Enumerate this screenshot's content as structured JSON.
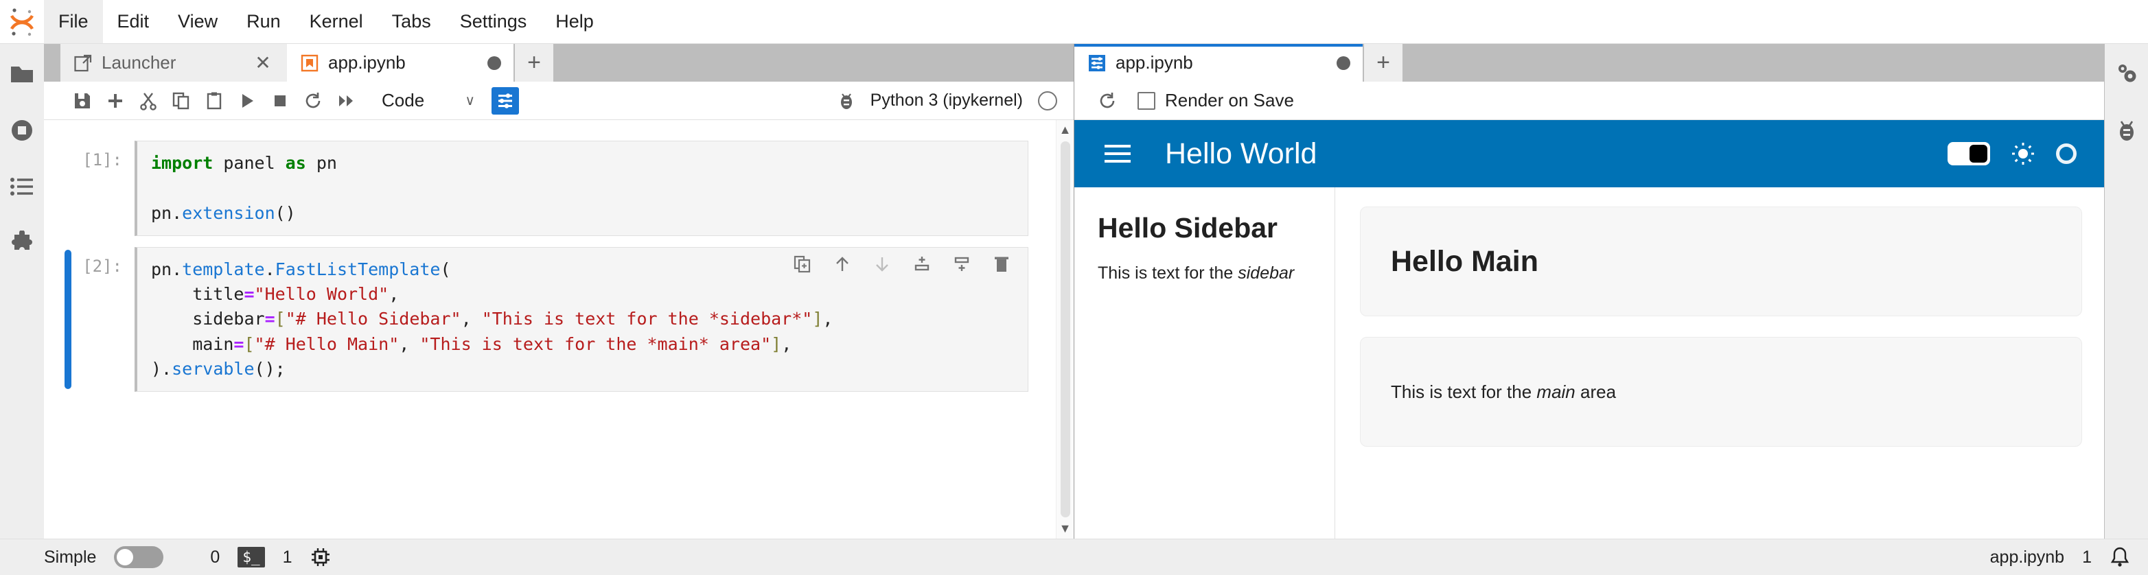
{
  "app": {
    "logo_name": "jupyter-logo"
  },
  "menubar": {
    "items": [
      {
        "label": "File",
        "active": true
      },
      {
        "label": "Edit",
        "active": false
      },
      {
        "label": "View",
        "active": false
      },
      {
        "label": "Run",
        "active": false
      },
      {
        "label": "Kernel",
        "active": false
      },
      {
        "label": "Tabs",
        "active": false
      },
      {
        "label": "Settings",
        "active": false
      },
      {
        "label": "Help",
        "active": false
      }
    ]
  },
  "left_rail": {
    "icons": [
      "folder-icon",
      "running-sessions-icon",
      "commands-icon",
      "extensions-icon"
    ]
  },
  "right_rail": {
    "icons": [
      "property-inspector-icon",
      "debugger-icon"
    ]
  },
  "notebook_dock": {
    "tabs": [
      {
        "label": "Launcher",
        "icon": "launcher-icon",
        "close_label": "✕",
        "current": false
      },
      {
        "label": "app.ipynb",
        "icon": "notebook-icon",
        "current": true,
        "dirty": true
      }
    ],
    "add_tab_label": "+",
    "toolbar": {
      "buttons": [
        "save-icon",
        "insert-cell-icon",
        "cut-icon",
        "copy-icon",
        "paste-icon",
        "run-icon",
        "stop-icon",
        "restart-icon",
        "restart-run-all-icon"
      ],
      "cell_type": "Code",
      "cell_type_caret": "∨",
      "settings_icon": "sliders-icon",
      "debug_icon": "bug-icon",
      "kernel_name": "Python 3 (ipykernel)",
      "kernel_status": "idle"
    },
    "cells": [
      {
        "prompt": "[1]:",
        "selected": false,
        "lines": [
          [
            {
              "t": "import",
              "c": "kw"
            },
            {
              "t": " panel ",
              "c": ""
            },
            {
              "t": "as",
              "c": "kw"
            },
            {
              "t": " pn",
              "c": ""
            }
          ],
          [],
          [
            {
              "t": "pn.",
              "c": ""
            },
            {
              "t": "extension",
              "c": "fn"
            },
            {
              "t": "()",
              "c": ""
            }
          ]
        ]
      },
      {
        "prompt": "[2]:",
        "selected": true,
        "lines": [
          [
            {
              "t": "pn.",
              "c": ""
            },
            {
              "t": "template",
              "c": "fn"
            },
            {
              "t": ".",
              "c": ""
            },
            {
              "t": "FastListTemplate",
              "c": "fn"
            },
            {
              "t": "(",
              "c": ""
            }
          ],
          [
            {
              "t": "    title",
              "c": ""
            },
            {
              "t": "=",
              "c": "op"
            },
            {
              "t": "\"Hello World\"",
              "c": "str"
            },
            {
              "t": ",",
              "c": ""
            }
          ],
          [
            {
              "t": "    sidebar",
              "c": ""
            },
            {
              "t": "=",
              "c": "op"
            },
            {
              "t": "[",
              "c": "brk"
            },
            {
              "t": "\"# Hello Sidebar\"",
              "c": "str"
            },
            {
              "t": ", ",
              "c": ""
            },
            {
              "t": "\"This is text for the *sidebar*\"",
              "c": "str"
            },
            {
              "t": "]",
              "c": "brk"
            },
            {
              "t": ",",
              "c": ""
            }
          ],
          [
            {
              "t": "    main",
              "c": ""
            },
            {
              "t": "=",
              "c": "op"
            },
            {
              "t": "[",
              "c": "brk"
            },
            {
              "t": "\"# Hello Main\"",
              "c": "str"
            },
            {
              "t": ", ",
              "c": ""
            },
            {
              "t": "\"This is text for the *main* area\"",
              "c": "str"
            },
            {
              "t": "]",
              "c": "brk"
            },
            {
              "t": ",",
              "c": ""
            }
          ],
          [
            {
              "t": ")",
              "c": ""
            },
            {
              "t": ".",
              "c": ""
            },
            {
              "t": "servable",
              "c": "fn"
            },
            {
              "t": "();",
              "c": ""
            }
          ]
        ],
        "cell_toolbar": [
          "duplicate-cell-icon",
          "move-cell-up-icon",
          "move-cell-down-icon",
          "insert-cell-above-icon",
          "insert-cell-below-icon",
          "delete-cell-icon"
        ]
      }
    ],
    "scrollbar": {
      "up": "▲",
      "down": "▼"
    }
  },
  "preview_dock": {
    "tab": {
      "label": "app.ipynb",
      "icon": "panel-preview-icon",
      "dirty": true
    },
    "add_tab_label": "+",
    "toolbar": {
      "reload_icon": "reload-icon",
      "render_on_save_label": "Render on Save",
      "render_on_save_checked": false
    },
    "panel_app": {
      "header": {
        "background": "#0072b5",
        "menu_icon": "hamburger-icon",
        "title": "Hello World",
        "theme_toggle_icon": "theme-toggle",
        "theme_toggle_on": true,
        "sun_icon": "sun-icon",
        "busy_icon": "busy-indicator-icon"
      },
      "sidebar": {
        "title": "Hello Sidebar",
        "text_before": "This is text for the ",
        "text_italic": "sidebar"
      },
      "main_cards": [
        {
          "kind": "title",
          "title": "Hello Main"
        },
        {
          "kind": "text",
          "text_before": "This is text for the ",
          "text_italic": "main",
          "text_after": " area"
        }
      ]
    }
  },
  "statusbar": {
    "mode_label": "Simple",
    "mode_on": false,
    "terminal_count": "0",
    "terminal_icon": "$_",
    "kernel_count": "1",
    "kernel_icon": "cpu-icon",
    "file_name": "app.ipynb",
    "notification_count": "1",
    "bell_icon": "bell-icon"
  }
}
